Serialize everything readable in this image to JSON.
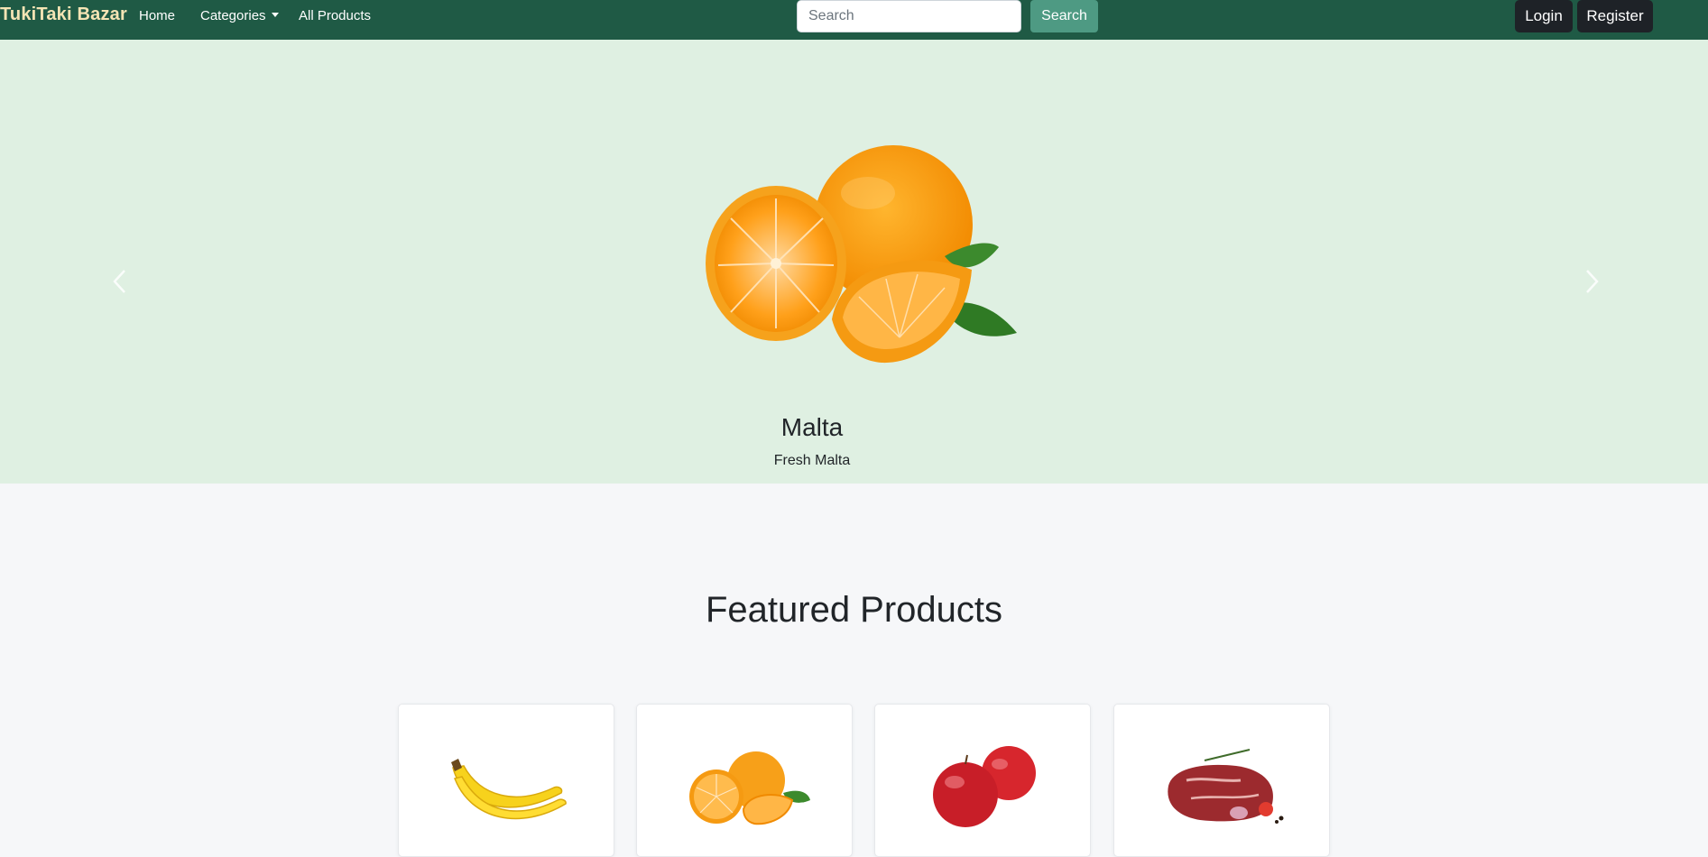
{
  "navbar": {
    "brand": "TukiTaki Bazar",
    "links": [
      {
        "label": "Home"
      },
      {
        "label": "Categories"
      },
      {
        "label": "All Products"
      }
    ],
    "search": {
      "placeholder": "Search",
      "value": "",
      "button_label": "Search"
    },
    "auth": {
      "login_label": "Login",
      "register_label": "Register"
    }
  },
  "hero": {
    "slide_title": "Malta",
    "slide_subtitle": "Fresh Malta",
    "prev_icon": "chevron-left-icon",
    "next_icon": "chevron-right-icon"
  },
  "featured": {
    "title": "Featured Products",
    "cards": [
      {
        "image": "banana"
      },
      {
        "image": "oranges"
      },
      {
        "image": "apples"
      },
      {
        "image": "beef-meat"
      }
    ]
  },
  "colors": {
    "navbar": "#1f5a45",
    "brand_text": "#f4e4b4",
    "search_button": "#4e9a83",
    "auth_button": "#1e2227",
    "hero_background": "#dff0e2",
    "page_background": "#f6f7f9"
  }
}
